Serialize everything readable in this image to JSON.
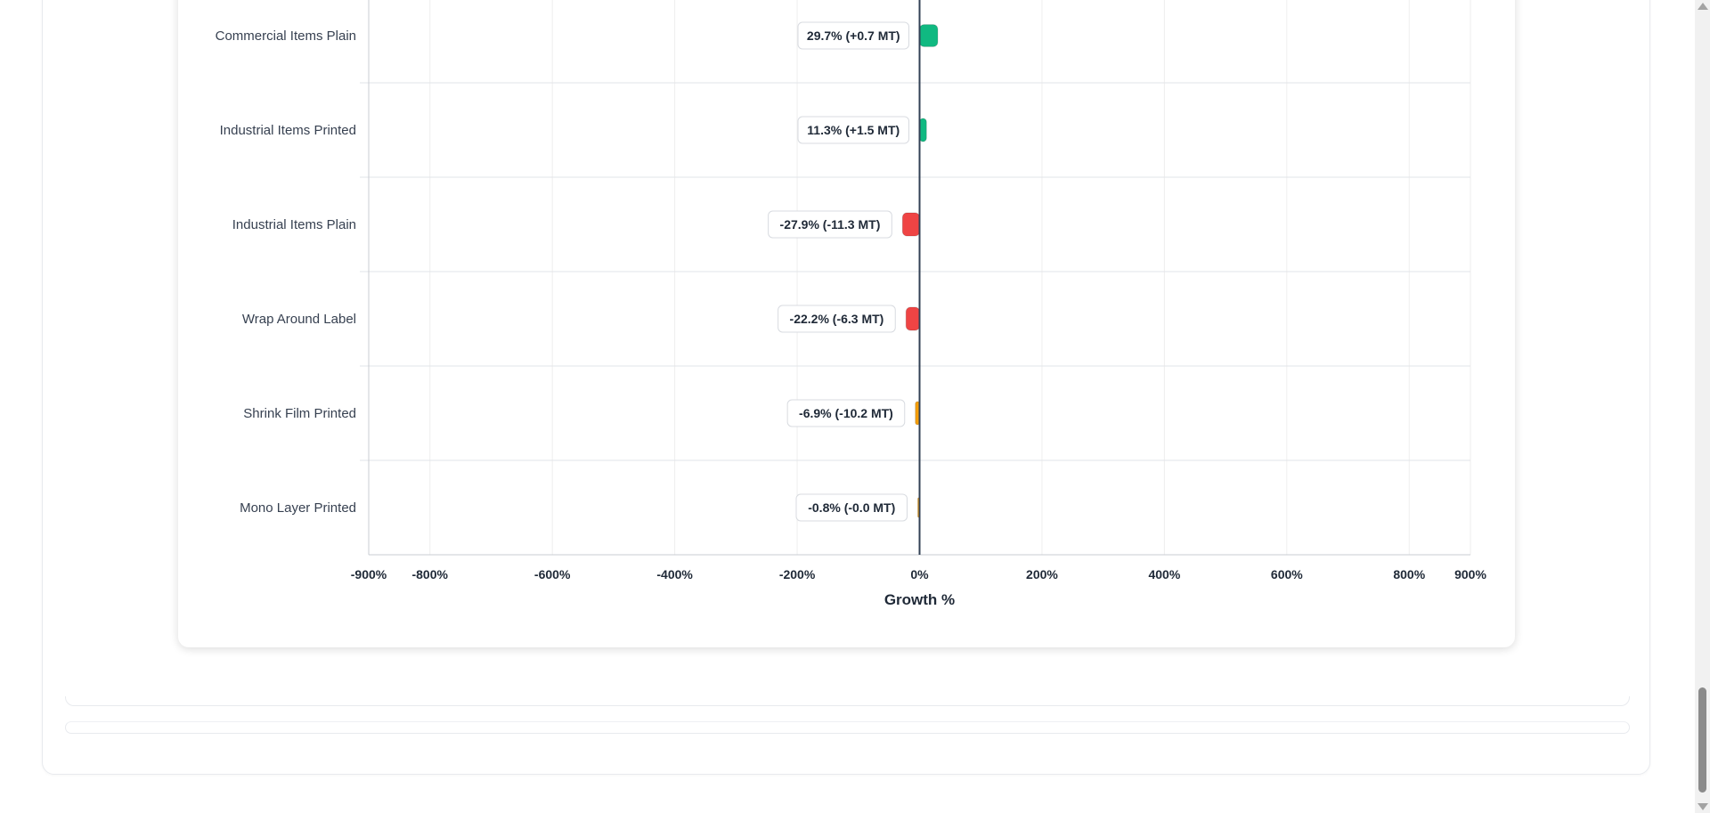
{
  "colors": {
    "positive": "#10b981",
    "negative": "#ef4444",
    "neutral": "#f59e0b",
    "zero_line": "#334155",
    "grid": "#eeeeee"
  },
  "chart_data": {
    "type": "bar",
    "orientation": "horizontal",
    "xlabel": "Growth %",
    "xlim": [
      -900,
      900
    ],
    "x_ticks": [
      -900,
      -800,
      -600,
      -400,
      -200,
      0,
      200,
      400,
      600,
      800,
      900
    ],
    "x_tick_labels": [
      "-900%",
      "-800%",
      "-600%",
      "-400%",
      "-200%",
      "0%",
      "200%",
      "400%",
      "600%",
      "800%",
      "900%"
    ],
    "grid": true,
    "categories": [
      "Commercial Items Plain",
      "Industrial Items Printed",
      "Industrial Items Plain",
      "Wrap Around Label",
      "Shrink Film Printed",
      "Mono Layer Printed"
    ],
    "values": [
      29.7,
      11.3,
      -27.9,
      -22.2,
      -6.9,
      -0.8
    ],
    "change_mt": [
      0.7,
      1.5,
      -11.3,
      -6.3,
      -10.2,
      -0.0
    ],
    "data_labels": [
      "29.7% (+0.7 MT)",
      "11.3% (+1.5 MT)",
      "-27.9% (-11.3 MT)",
      "-22.2% (-6.3 MT)",
      "-6.9% (-10.2 MT)",
      "-0.8% (-0.0 MT)"
    ],
    "bar_colors": [
      "#10b981",
      "#10b981",
      "#ef4444",
      "#ef4444",
      "#f59e0b",
      "#f59e0b"
    ]
  }
}
